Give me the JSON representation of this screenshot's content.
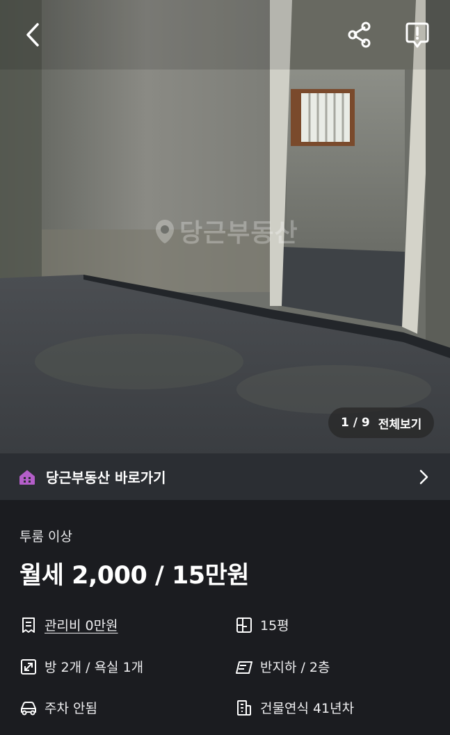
{
  "header": {
    "back_icon": "chevron-left-icon",
    "share_icon": "share-icon",
    "report_icon": "report-icon"
  },
  "photo": {
    "watermark": "당근부동산",
    "counter_current": "1",
    "counter_separator": "/",
    "counter_total": "9",
    "view_all_label": "전체보기"
  },
  "banner": {
    "label": "당근부동산 바로가기",
    "icon": "house-icon",
    "accent_color": "#b45ec9"
  },
  "listing": {
    "room_type": "투룸 이상",
    "price": "월세 2,000 / 15만원",
    "specs": {
      "maintenance": "관리비 0만원",
      "area": "15평",
      "rooms": "방 2개 / 욕실 1개",
      "floor": "반지하 / 2층",
      "parking": "주차 안됨",
      "building_age": "건물연식 41년차"
    }
  }
}
